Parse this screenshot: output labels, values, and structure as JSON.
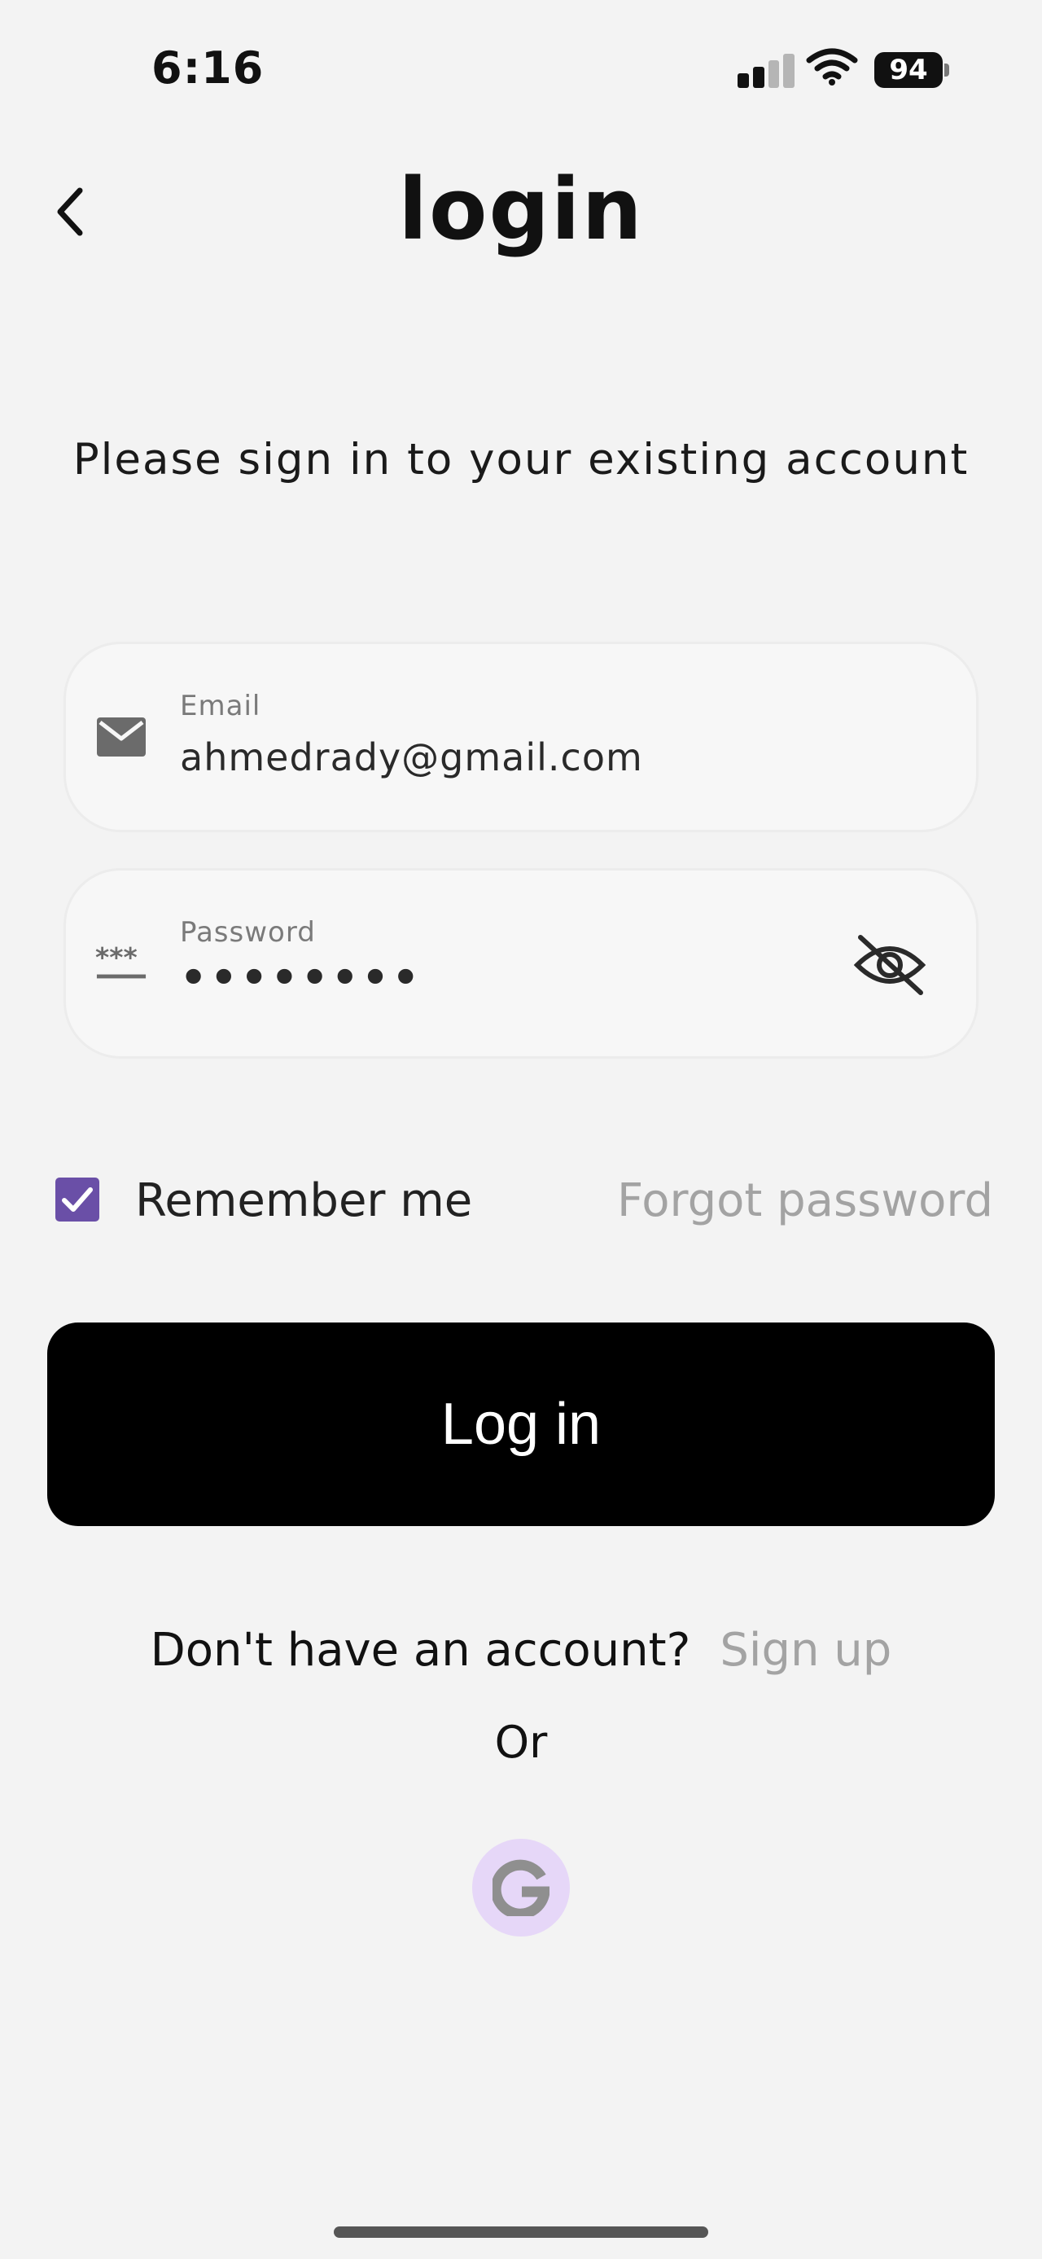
{
  "status_bar": {
    "time": "6:16",
    "battery": "94",
    "icons": [
      "cellular-signal-icon",
      "wifi-icon",
      "battery-icon"
    ]
  },
  "header": {
    "title": "login",
    "back_icon": "chevron-left-icon"
  },
  "subtitle": "Please sign in to your existing account",
  "email_field": {
    "label": "Email",
    "value": "ahmedrady@gmail.com",
    "icon": "envelope-icon"
  },
  "password_field": {
    "label": "Password",
    "value": "••••••••",
    "icon": "password-asterisk-icon",
    "toggle_icon": "eye-off-icon"
  },
  "remember_me": {
    "label": "Remember me",
    "checked": true
  },
  "forgot_password": "Forgot password",
  "login_button": "Log in",
  "signup": {
    "question": "Don't have an account?",
    "link": "Sign up"
  },
  "or_text": "Or",
  "google_button": {
    "icon": "google-icon"
  },
  "colors": {
    "background": "#f3f3f3",
    "accent": "#6a4fa7",
    "button": "#000000",
    "muted_link": "#a3a3a3",
    "google_bg": "#e6d7f8"
  }
}
